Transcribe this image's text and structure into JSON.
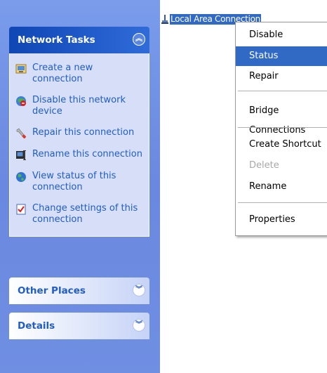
{
  "network_tasks": {
    "title": "Network Tasks",
    "collapse_glyph": "≈",
    "items": [
      {
        "label": "Create a new connection",
        "icon": "new-connection-icon"
      },
      {
        "label": "Disable this network device",
        "icon": "disable-network-icon"
      },
      {
        "label": "Repair this connection",
        "icon": "repair-wrench-icon"
      },
      {
        "label": "Rename this connection",
        "icon": "rename-icon"
      },
      {
        "label": "View status of this connection",
        "icon": "globe-status-icon"
      },
      {
        "label": "Change settings of this connection",
        "icon": "settings-checklist-icon"
      }
    ]
  },
  "other_places": {
    "title": "Other Places",
    "expand_glyph": "¥"
  },
  "details": {
    "title": "Details",
    "expand_glyph": "¥"
  },
  "connection": {
    "label": "Local Area Connection"
  },
  "context_menu": {
    "items": [
      {
        "label": "Disable",
        "state": "normal"
      },
      {
        "label": "Status",
        "state": "selected"
      },
      {
        "label": "Repair",
        "state": "normal"
      },
      {
        "label": "Bridge Connections",
        "state": "normal"
      },
      {
        "label": "Create Shortcut",
        "state": "normal"
      },
      {
        "label": "Delete",
        "state": "disabled"
      },
      {
        "label": "Rename",
        "state": "normal"
      },
      {
        "label": "Properties",
        "state": "normal"
      }
    ]
  },
  "colors": {
    "accent": "#316ac5",
    "pane": "#6f8fe3",
    "link": "#215dc6"
  }
}
